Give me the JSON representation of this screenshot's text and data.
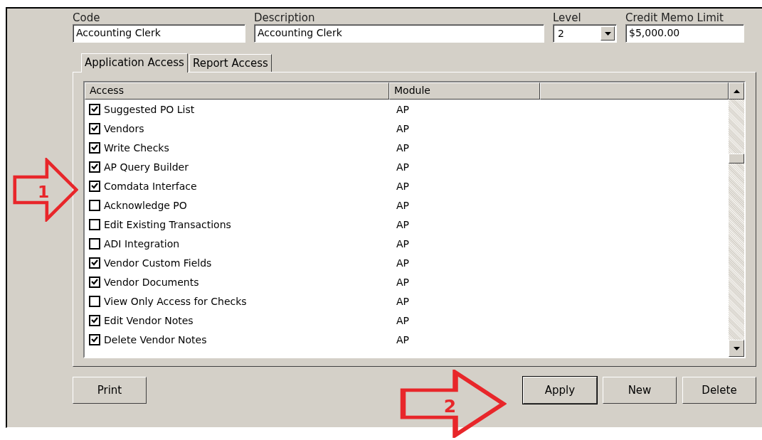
{
  "fields": {
    "code": {
      "label": "Code",
      "value": "Accounting Clerk"
    },
    "description": {
      "label": "Description",
      "value": "Accounting Clerk"
    },
    "level": {
      "label": "Level",
      "value": "2"
    },
    "credit_memo_limit": {
      "label": "Credit Memo Limit",
      "value": "$5,000.00"
    }
  },
  "tabs": [
    {
      "label": "Application Access",
      "selected": true
    },
    {
      "label": "Report Access",
      "selected": false
    }
  ],
  "table": {
    "columns": [
      "Access",
      "Module"
    ],
    "rows": [
      {
        "access": "Suggested PO List",
        "module": "AP",
        "checked": true
      },
      {
        "access": "Vendors",
        "module": "AP",
        "checked": true
      },
      {
        "access": "Write Checks",
        "module": "AP",
        "checked": true
      },
      {
        "access": "AP Query Builder",
        "module": "AP",
        "checked": true
      },
      {
        "access": "Comdata Interface",
        "module": "AP",
        "checked": true
      },
      {
        "access": "Acknowledge PO",
        "module": "AP",
        "checked": false
      },
      {
        "access": "Edit Existing Transactions",
        "module": "AP",
        "checked": false
      },
      {
        "access": "ADI Integration",
        "module": "AP",
        "checked": false
      },
      {
        "access": "Vendor Custom Fields",
        "module": "AP",
        "checked": true
      },
      {
        "access": "Vendor Documents",
        "module": "AP",
        "checked": true
      },
      {
        "access": "View Only Access for Checks",
        "module": "AP",
        "checked": false
      },
      {
        "access": "Edit Vendor Notes",
        "module": "AP",
        "checked": true
      },
      {
        "access": "Delete Vendor Notes",
        "module": "AP",
        "checked": true
      }
    ]
  },
  "buttons": {
    "left": [
      "Print"
    ],
    "right": [
      {
        "label": "Apply",
        "default": true
      },
      {
        "label": "New",
        "default": false
      },
      {
        "label": "Delete",
        "default": false
      }
    ]
  },
  "annotations": [
    {
      "label": "1"
    },
    {
      "label": "2"
    }
  ]
}
